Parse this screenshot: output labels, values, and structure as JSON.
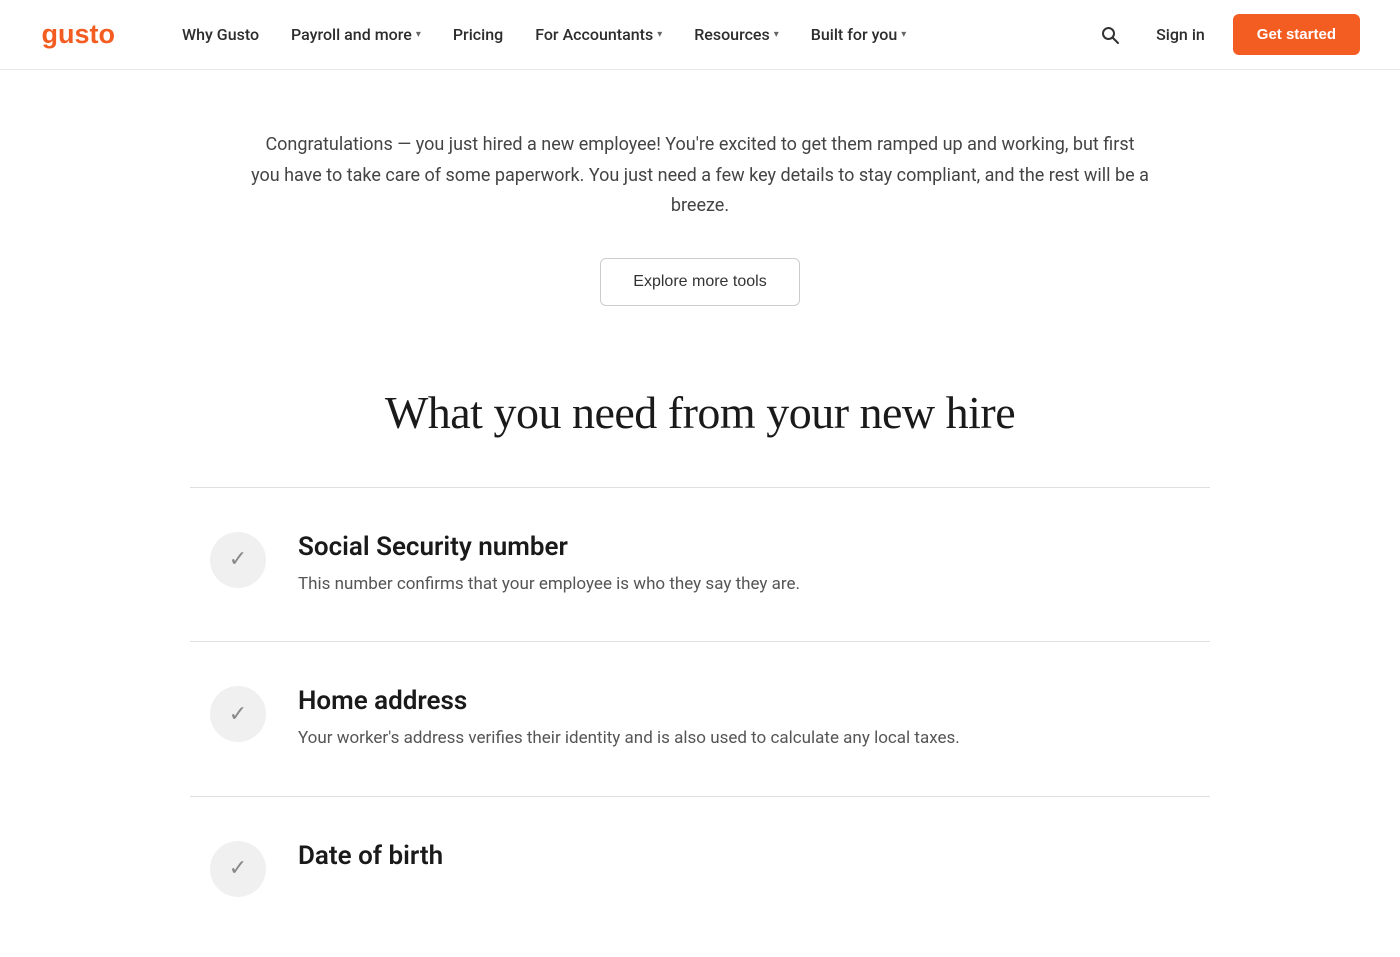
{
  "navbar": {
    "logo_alt": "Gusto",
    "links": [
      {
        "id": "why-gusto",
        "label": "Why Gusto",
        "has_dropdown": false
      },
      {
        "id": "payroll-and-more",
        "label": "Payroll and more",
        "has_dropdown": true
      },
      {
        "id": "pricing",
        "label": "Pricing",
        "has_dropdown": false
      },
      {
        "id": "for-accountants",
        "label": "For Accountants",
        "has_dropdown": true
      },
      {
        "id": "resources",
        "label": "Resources",
        "has_dropdown": true
      },
      {
        "id": "built-for-you",
        "label": "Built for you",
        "has_dropdown": true
      }
    ],
    "sign_in_label": "Sign in",
    "get_started_label": "Get started"
  },
  "main": {
    "intro_text": "Congratulations — you just hired a new employee! You're excited to get them ramped up and working, but first you have to take care of some paperwork. You just need a few key details to stay compliant, and the rest will be a breeze.",
    "explore_button_label": "Explore more tools",
    "section_title": "What you need from your new hire",
    "items": [
      {
        "id": "social-security-number",
        "title": "Social Security number",
        "description": "This number confirms that your employee is who they say they are."
      },
      {
        "id": "home-address",
        "title": "Home address",
        "description": "Your worker's address verifies their identity and is also used to calculate any local taxes."
      },
      {
        "id": "date-of-birth",
        "title": "Date of birth",
        "description": ""
      }
    ]
  },
  "colors": {
    "accent": "#f45d22",
    "check_bg": "#f0f0f0",
    "check_color": "#888888"
  }
}
